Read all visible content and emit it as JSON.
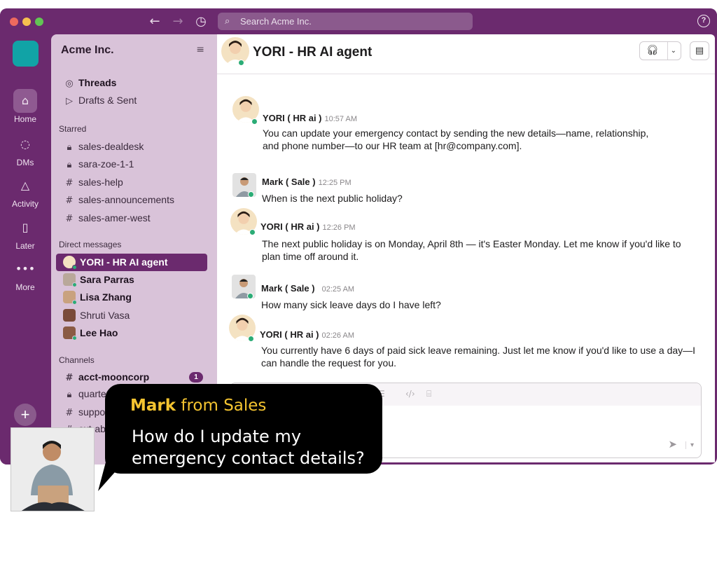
{
  "window": {
    "search_placeholder": "Search Acme Inc.",
    "colors": {
      "aubergine": "#6b2a6e",
      "sidebar": "#d9c3d9",
      "online": "#2bac76",
      "workspace": "#11a3a6",
      "highlight": "#f4c430"
    }
  },
  "rail": {
    "items": [
      {
        "label": "Home",
        "icon": "home-icon"
      },
      {
        "label": "DMs",
        "icon": "dms-icon"
      },
      {
        "label": "Activity",
        "icon": "bell-icon"
      },
      {
        "label": "Later",
        "icon": "bookmark-icon"
      },
      {
        "label": "More",
        "icon": "more-icon"
      }
    ]
  },
  "sidebar": {
    "workspace": "Acme Inc.",
    "top": [
      {
        "label": "Threads",
        "icon": "threads-icon"
      },
      {
        "label": "Drafts & Sent",
        "icon": "send-icon"
      }
    ],
    "starred_heading": "Starred",
    "starred": [
      {
        "label": "sales-dealdesk",
        "icon": "lock-icon"
      },
      {
        "label": "sara-zoe-1-1",
        "icon": "lock-icon"
      },
      {
        "label": "sales-help",
        "icon": "hash-icon"
      },
      {
        "label": "sales-announcements",
        "icon": "hash-icon"
      },
      {
        "label": "sales-amer-west",
        "icon": "hash-icon"
      }
    ],
    "dm_heading": "Direct messages",
    "dms": [
      {
        "label": "YORI - HR AI agent"
      },
      {
        "label": "Sara Parras"
      },
      {
        "label": "Lisa Zhang"
      },
      {
        "label": "Shruti Vasa"
      },
      {
        "label": "Lee Hao"
      }
    ],
    "channels_heading": "Channels",
    "channels": [
      {
        "label": "acct-mooncorp",
        "icon": "hash-icon",
        "badge": "1"
      },
      {
        "label": "quarterly-planning",
        "icon": "lock-icon"
      },
      {
        "label": "support",
        "icon": "hash-icon"
      },
      {
        "label": "ext-abc",
        "icon": "hash-icon"
      }
    ]
  },
  "channel": {
    "title": "YORI - HR AI agent"
  },
  "messages": [
    {
      "sender": "YORI ( HR ai )",
      "time": "10:57 AM",
      "text": "You can update your emergency contact by sending the new details—name, relationship, and phone number—to our HR team at [hr@company.com]."
    },
    {
      "sender": "Mark ( Sale )",
      "time": "12:25 PM",
      "text": "When is the next public holiday?"
    },
    {
      "sender": "YORI ( HR ai )",
      "time": "12:26 PM",
      "text": "The next public holiday is on Monday, April 8th — it's Easter Monday. Let me know if you'd like to plan time off around it."
    },
    {
      "sender": "Mark ( Sale )",
      "time": "02:25 AM",
      "text": "How many sick leave days do I have left?"
    },
    {
      "sender": "YORI ( HR ai )",
      "time": "02:26 AM",
      "text": "You currently have 6 days of paid sick leave remaining. Just let me know if you'd like to use a day—I can handle the request for you."
    }
  ],
  "overlay": {
    "name_bold": "Mark",
    "name_rest": " from Sales",
    "question": "How do I update my emergency contact details?"
  }
}
